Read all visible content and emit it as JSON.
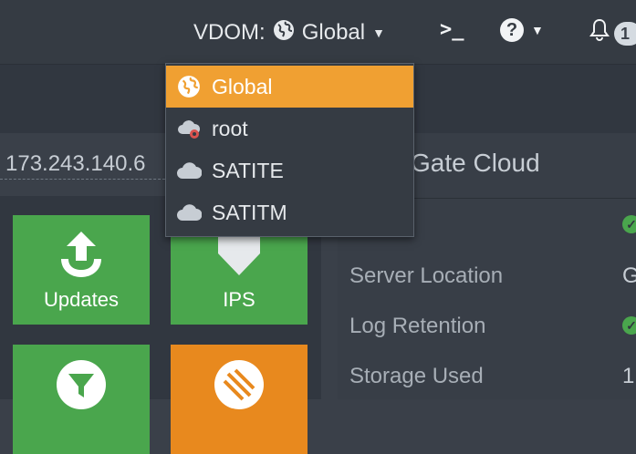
{
  "header": {
    "vdom_label": "VDOM:",
    "vdom_value": "Global",
    "notifications_count": "1"
  },
  "vdom_menu": {
    "items": [
      {
        "label": "Global",
        "icon": "globe-icon"
      },
      {
        "label": "root",
        "icon": "cloud-gear-icon"
      },
      {
        "label": "SATITE",
        "icon": "cloud-icon"
      },
      {
        "label": "SATITM",
        "icon": "cloud-icon"
      }
    ]
  },
  "ip_address": "173.243.140.6",
  "tiles": {
    "updates": "Updates",
    "ips": "IPS"
  },
  "cloud_panel": {
    "title": "Gate Cloud",
    "rows": [
      {
        "label": "Server Location",
        "value": "G"
      },
      {
        "label": "Log Retention",
        "value": ""
      },
      {
        "label": "Storage Used",
        "value": "1"
      }
    ]
  },
  "colors": {
    "accent": "#f0a032",
    "tile_green": "#4aa64d",
    "tile_orange": "#e8891e",
    "background": "#3a4049"
  }
}
